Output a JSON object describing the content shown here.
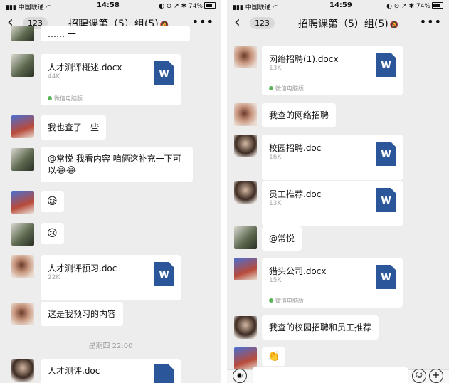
{
  "left": {
    "status": {
      "carrier": "中国联通",
      "time": "14:58",
      "battery": "74%"
    },
    "nav": {
      "badge": "123",
      "title": "招聘课第（5）组(5)"
    },
    "messages": {
      "partial_text": "…… 一",
      "file1": {
        "name": "人才测评概述.docx",
        "size": "44K",
        "source": "微信电脑版",
        "icon": "W"
      },
      "text1": "我也查了一些",
      "text2": "@常悦 我看内容 咱俩这补充一下可以😂😂",
      "emoji1": "😪",
      "emoji2": "😢",
      "file2": {
        "name": "人才测评预习.doc",
        "size": "22K",
        "icon": "W"
      },
      "text3": "这是我预习的内容",
      "time_sep": "星期四 22:00",
      "file3": {
        "name": "人才测评.doc"
      }
    }
  },
  "right": {
    "status": {
      "carrier": "中国联通",
      "time": "14:59",
      "battery": "74%"
    },
    "nav": {
      "badge": "123",
      "title": "招聘课第（5）组(5)"
    },
    "messages": {
      "file1": {
        "name": "网络招聘(1).docx",
        "size": "13K",
        "source": "微信电脑版",
        "icon": "W"
      },
      "text1": "我查的网络招聘",
      "file2": {
        "name": "校园招聘.doc",
        "size": "16K",
        "icon": "W"
      },
      "file3": {
        "name": "员工推荐.doc",
        "size": "13K",
        "icon": "W"
      },
      "text2": "@常悦",
      "file4": {
        "name": "猎头公司.docx",
        "size": "15K",
        "source": "微信电脑版",
        "icon": "W"
      },
      "text3": "我查的校园招聘和员工推荐",
      "emoji1": "👏"
    }
  },
  "icons": {
    "back": "chevron-left-icon",
    "more": "more-dots-icon",
    "word": "word-doc-icon",
    "voice": "voice-icon",
    "emoji": "emoji-icon",
    "plus": "plus-icon"
  }
}
